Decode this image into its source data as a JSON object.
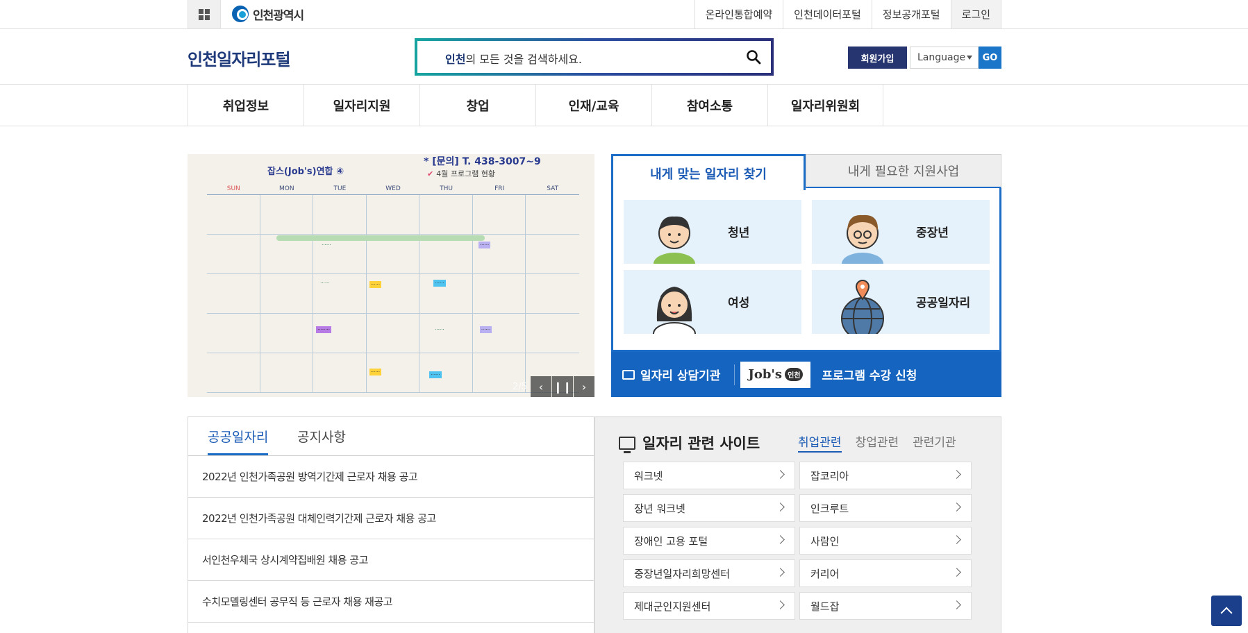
{
  "util": {
    "city_name": "인천광역시",
    "links": [
      "온라인통합예약",
      "인천데이터포털",
      "정보공개포털",
      "로그인"
    ]
  },
  "header": {
    "site_title": "인천일자리포털",
    "search_bold": "인천",
    "search_rest": "의 모든 것을 검색하세요.",
    "join_label": "회원가입",
    "language_label": "Language",
    "go_label": "GO"
  },
  "gnb": [
    "취업정보",
    "일자리지원",
    "창업",
    "인재/교육",
    "참여소통",
    "일자리위원회"
  ],
  "banner": {
    "title": "잡스(Job's)연합 ④",
    "contact": "* [문의] T. 438-3007~9",
    "subtitle": "4월 프로그램 현황",
    "days": [
      "SUN",
      "MON",
      "TUE",
      "WED",
      "THU",
      "FRI",
      "SAT"
    ],
    "page_indicator": "2/5",
    "prev_icon": "chevron-left-icon",
    "pause_icon": "pause-icon",
    "next_icon": "chevron-right-icon"
  },
  "finder": {
    "tab_active": "내게 맞는 일자리 찾기",
    "tab_inactive": "내게 필요한 지원사업",
    "cards": [
      "청년",
      "중장년",
      "여성",
      "공공일자리"
    ],
    "bottom_link1": "일자리 상담기관",
    "jobs_logo": "Job's",
    "jobs_badge": "인천",
    "bottom_link2": "프로그램 수강 신청"
  },
  "board": {
    "tab_active": "공공일자리",
    "tab_inactive": "공지사항",
    "items": [
      "2022년 인천가족공원 방역기간제 근로자 채용 공고",
      "2022년 인천가족공원 대체인력기간제 근로자 채용 공고",
      "서인천우체국 상시계약집배원 채용 공고",
      "수치모델링센터 공무직 등 근로자 채용 재공고"
    ]
  },
  "sites": {
    "title": "일자리 관련 사이트",
    "tabs": [
      "취업관련",
      "창업관련",
      "관련기관"
    ],
    "items": [
      "워크넷",
      "잡코리아",
      "장년 워크넷",
      "인크루트",
      "장애인 고용 포털",
      "사람인",
      "중장년일자리희망센터",
      "커리어",
      "제대군인지원센터",
      "월드잡"
    ]
  },
  "colors": {
    "primary": "#1565c0",
    "navy": "#263470",
    "title": "#1f3a7a"
  }
}
